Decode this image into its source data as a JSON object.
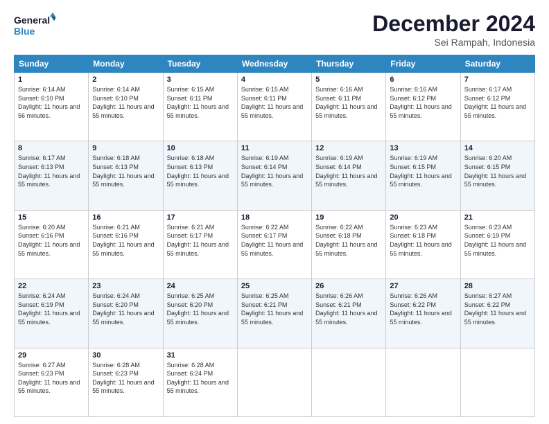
{
  "logo": {
    "line1": "General",
    "line2": "Blue"
  },
  "header": {
    "month": "December 2024",
    "location": "Sei Rampah, Indonesia"
  },
  "days_of_week": [
    "Sunday",
    "Monday",
    "Tuesday",
    "Wednesday",
    "Thursday",
    "Friday",
    "Saturday"
  ],
  "weeks": [
    [
      {
        "day": "1",
        "sunrise": "6:14 AM",
        "sunset": "6:10 PM",
        "daylight": "11 hours and 56 minutes."
      },
      {
        "day": "2",
        "sunrise": "6:14 AM",
        "sunset": "6:10 PM",
        "daylight": "11 hours and 55 minutes."
      },
      {
        "day": "3",
        "sunrise": "6:15 AM",
        "sunset": "6:11 PM",
        "daylight": "11 hours and 55 minutes."
      },
      {
        "day": "4",
        "sunrise": "6:15 AM",
        "sunset": "6:11 PM",
        "daylight": "11 hours and 55 minutes."
      },
      {
        "day": "5",
        "sunrise": "6:16 AM",
        "sunset": "6:11 PM",
        "daylight": "11 hours and 55 minutes."
      },
      {
        "day": "6",
        "sunrise": "6:16 AM",
        "sunset": "6:12 PM",
        "daylight": "11 hours and 55 minutes."
      },
      {
        "day": "7",
        "sunrise": "6:17 AM",
        "sunset": "6:12 PM",
        "daylight": "11 hours and 55 minutes."
      }
    ],
    [
      {
        "day": "8",
        "sunrise": "6:17 AM",
        "sunset": "6:13 PM",
        "daylight": "11 hours and 55 minutes."
      },
      {
        "day": "9",
        "sunrise": "6:18 AM",
        "sunset": "6:13 PM",
        "daylight": "11 hours and 55 minutes."
      },
      {
        "day": "10",
        "sunrise": "6:18 AM",
        "sunset": "6:13 PM",
        "daylight": "11 hours and 55 minutes."
      },
      {
        "day": "11",
        "sunrise": "6:19 AM",
        "sunset": "6:14 PM",
        "daylight": "11 hours and 55 minutes."
      },
      {
        "day": "12",
        "sunrise": "6:19 AM",
        "sunset": "6:14 PM",
        "daylight": "11 hours and 55 minutes."
      },
      {
        "day": "13",
        "sunrise": "6:19 AM",
        "sunset": "6:15 PM",
        "daylight": "11 hours and 55 minutes."
      },
      {
        "day": "14",
        "sunrise": "6:20 AM",
        "sunset": "6:15 PM",
        "daylight": "11 hours and 55 minutes."
      }
    ],
    [
      {
        "day": "15",
        "sunrise": "6:20 AM",
        "sunset": "6:16 PM",
        "daylight": "11 hours and 55 minutes."
      },
      {
        "day": "16",
        "sunrise": "6:21 AM",
        "sunset": "6:16 PM",
        "daylight": "11 hours and 55 minutes."
      },
      {
        "day": "17",
        "sunrise": "6:21 AM",
        "sunset": "6:17 PM",
        "daylight": "11 hours and 55 minutes."
      },
      {
        "day": "18",
        "sunrise": "6:22 AM",
        "sunset": "6:17 PM",
        "daylight": "11 hours and 55 minutes."
      },
      {
        "day": "19",
        "sunrise": "6:22 AM",
        "sunset": "6:18 PM",
        "daylight": "11 hours and 55 minutes."
      },
      {
        "day": "20",
        "sunrise": "6:23 AM",
        "sunset": "6:18 PM",
        "daylight": "11 hours and 55 minutes."
      },
      {
        "day": "21",
        "sunrise": "6:23 AM",
        "sunset": "6:19 PM",
        "daylight": "11 hours and 55 minutes."
      }
    ],
    [
      {
        "day": "22",
        "sunrise": "6:24 AM",
        "sunset": "6:19 PM",
        "daylight": "11 hours and 55 minutes."
      },
      {
        "day": "23",
        "sunrise": "6:24 AM",
        "sunset": "6:20 PM",
        "daylight": "11 hours and 55 minutes."
      },
      {
        "day": "24",
        "sunrise": "6:25 AM",
        "sunset": "6:20 PM",
        "daylight": "11 hours and 55 minutes."
      },
      {
        "day": "25",
        "sunrise": "6:25 AM",
        "sunset": "6:21 PM",
        "daylight": "11 hours and 55 minutes."
      },
      {
        "day": "26",
        "sunrise": "6:26 AM",
        "sunset": "6:21 PM",
        "daylight": "11 hours and 55 minutes."
      },
      {
        "day": "27",
        "sunrise": "6:26 AM",
        "sunset": "6:22 PM",
        "daylight": "11 hours and 55 minutes."
      },
      {
        "day": "28",
        "sunrise": "6:27 AM",
        "sunset": "6:22 PM",
        "daylight": "11 hours and 55 minutes."
      }
    ],
    [
      {
        "day": "29",
        "sunrise": "6:27 AM",
        "sunset": "6:23 PM",
        "daylight": "11 hours and 55 minutes."
      },
      {
        "day": "30",
        "sunrise": "6:28 AM",
        "sunset": "6:23 PM",
        "daylight": "11 hours and 55 minutes."
      },
      {
        "day": "31",
        "sunrise": "6:28 AM",
        "sunset": "6:24 PM",
        "daylight": "11 hours and 55 minutes."
      },
      null,
      null,
      null,
      null
    ]
  ],
  "labels": {
    "sunrise": "Sunrise:",
    "sunset": "Sunset:",
    "daylight": "Daylight:"
  }
}
